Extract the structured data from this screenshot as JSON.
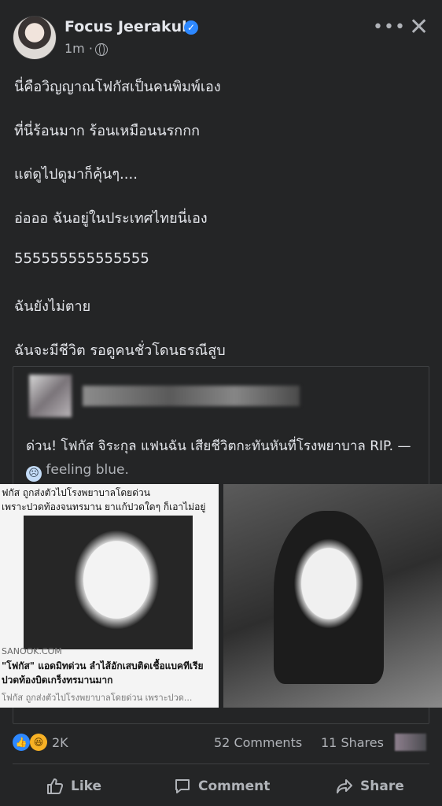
{
  "post": {
    "author": "Focus Jeerakul",
    "time": "1m",
    "dot": "·",
    "menu_icon": "more-icon",
    "close_icon": "close-icon",
    "lines": [
      "นี่คือวิญญาณโฟกัสเป็นคนพิมพ์เอง",
      "ที่นี่ร้อนมาก ร้อนเหมือนนรกกก",
      "แต่ดูไปดูมาก็คุ้นๆ....",
      "อ่อออ ฉันอยู่ในประเทศไทยนี่เอง",
      "555555555555555",
      "ฉันยังไม่ตาย",
      "ฉันจะมีชีวิต รอดูคนชั่วโดนธรณีสูบ"
    ]
  },
  "shared_post": {
    "text": "ด่วน! โฟกัส จิระกุล แฟนฉัน เสียชีวิตกะทันหันที่โรงพยาบาล RIP. —",
    "feeling": "feeling blue."
  },
  "photo_left": {
    "top_line_1": "ฟกัส ถูกส่งตัวไปโรงพยาบาลโดยด่วน",
    "top_line_2": "เพราะปวดท้องจนทรมาน ยาแก้ปวดใดๆ ก็เอาไม่อยู่",
    "source": "SANOOK.COM",
    "headline_1": "\"โฟกัส\" แอดมิทด่วน ลำไส้อักเสบติดเชื้อแบคทีเรีย",
    "headline_2": "ปวดท้องบิดเกร็งทรมานมาก",
    "description": "โฟกัส ถูกส่งตัวไปโรงพยาบาลโดยด่วน เพราะปวด..."
  },
  "stats": {
    "reactions": "2K",
    "comments": "52 Comments",
    "shares": "11 Shares"
  },
  "actions": {
    "like": "Like",
    "comment": "Comment",
    "share": "Share"
  },
  "colors": {
    "background": "#242526",
    "text": "#e4e6eb",
    "secondary_text": "#b0b3b8",
    "verified": "#2d88ff"
  }
}
